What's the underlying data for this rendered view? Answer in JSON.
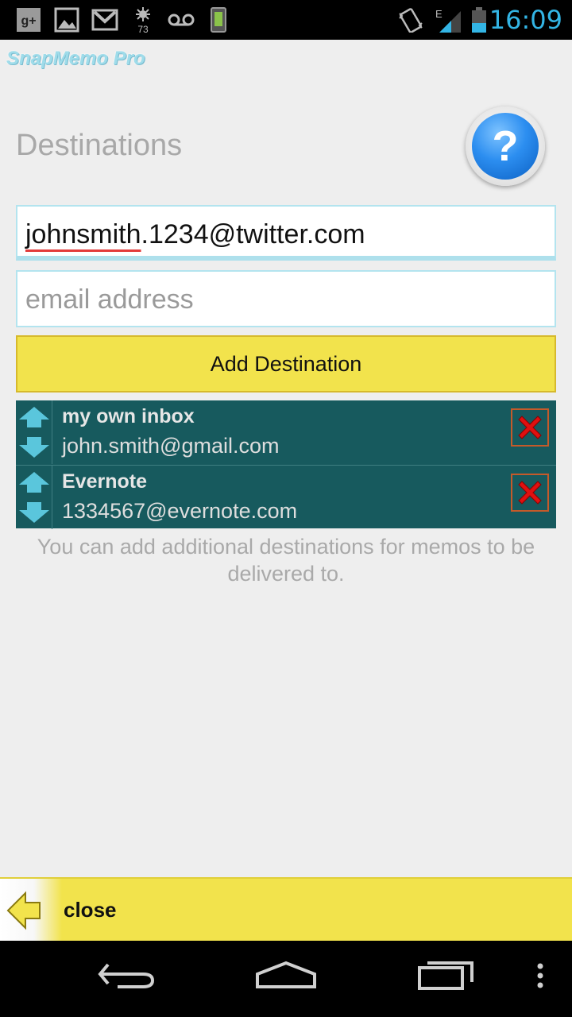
{
  "status_bar": {
    "time": "16:09",
    "icons": [
      "google-plus-icon",
      "image-icon",
      "gmail-icon",
      "weather-icon",
      "voicemail-icon",
      "battery-app-icon",
      "vibrate-icon",
      "signal-icon",
      "battery-icon"
    ],
    "weather_temp": "73",
    "network_type": "E"
  },
  "app": {
    "title": "SnapMemo Pro",
    "title_color": "#9fdcea"
  },
  "destinations": {
    "heading": "Destinations",
    "help_symbol": "?",
    "input_value_underlined": "johnsmith",
    "input_value_rest": ".1234@twitter.com",
    "email_placeholder": "email address",
    "add_button_label": "Add Destination",
    "items": [
      {
        "name": "my own inbox",
        "email": "john.smith@gmail.com"
      },
      {
        "name": "Evernote",
        "email": "1334567@evernote.com"
      }
    ],
    "info": "You can add additional destinations for memos to be delivered to."
  },
  "footer": {
    "close_label": "close"
  },
  "colors": {
    "accent_yellow": "#f2e34c",
    "list_bg": "#175a5e",
    "holo_blue": "#33b5e5"
  }
}
